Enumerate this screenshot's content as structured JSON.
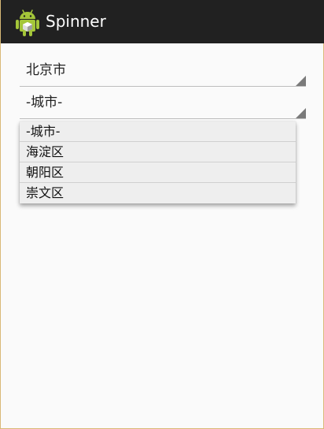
{
  "app": {
    "title": "Spinner",
    "icon": "android-robot-icon"
  },
  "province_spinner": {
    "selected": "北京市"
  },
  "city_spinner": {
    "selected": "-城市-"
  },
  "city_dropdown": {
    "options": [
      "-城市-",
      "海淀区",
      "朝阳区",
      "崇文区"
    ]
  },
  "colors": {
    "action_bar": "#212121",
    "android_green": "#a4c639",
    "background": "#fafafa"
  }
}
